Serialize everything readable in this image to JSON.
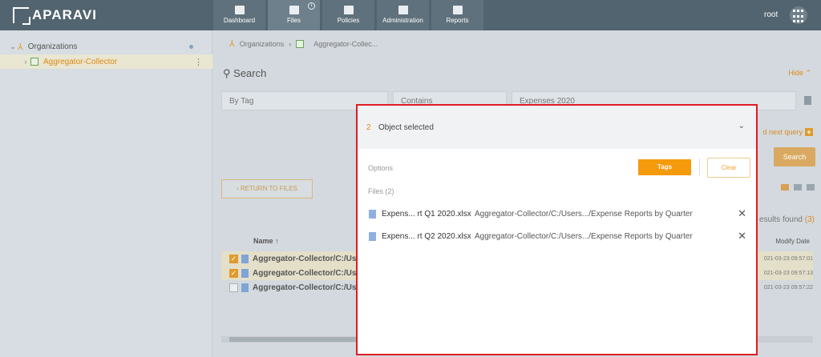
{
  "brand": {
    "name": "APARAVI"
  },
  "nav": {
    "items": [
      {
        "label": "Dashboard",
        "icon": "dashboard-icon"
      },
      {
        "label": "Files",
        "icon": "folder-icon"
      },
      {
        "label": "Policies",
        "icon": "policies-icon"
      },
      {
        "label": "Administration",
        "icon": "administration-icon"
      },
      {
        "label": "Reports",
        "icon": "reports-icon"
      }
    ],
    "active": "Files"
  },
  "user": {
    "name": "root"
  },
  "sidebar": {
    "items": [
      {
        "label": "Organizations"
      },
      {
        "label": "Aggregator-Collector"
      }
    ]
  },
  "breadcrumb": {
    "items": [
      "Organizations",
      "Aggregator-Collec..."
    ]
  },
  "search": {
    "title": "Search",
    "hide_label": "Hide",
    "filter_field": "By Tag",
    "operator": "Contains",
    "value": "Expenses 2020",
    "next_query_label": "d next query",
    "search_label": "Search"
  },
  "results": {
    "return_label": "RETURN TO FILES",
    "found_text": "esults found",
    "count": "(3)",
    "col_name": "Name",
    "col_date": "Modify Date",
    "rows": [
      {
        "name": "Aggregator-Collector/C:/Use",
        "date": "021-03-23 09:57:01",
        "checked": true
      },
      {
        "name": "Aggregator-Collector/C:/Use",
        "date": "021-03-23 09:57:13",
        "checked": true
      },
      {
        "name": "Aggregator-Collector/C:/Use",
        "date": "021-03-23 09:57:22",
        "checked": false
      }
    ]
  },
  "modal": {
    "count": "2",
    "title": "Object selected",
    "options_label": "Options",
    "tags_label": "Tags",
    "clear_label": "Clear",
    "files_label": "Files (2)",
    "files": [
      {
        "name": "Expens... rt Q1 2020.xlsx",
        "path": "Aggregator-Collector/C:/Users.../Expense Reports by Quarter"
      },
      {
        "name": "Expens... rt Q2 2020.xlsx",
        "path": "Aggregator-Collector/C:/Users.../Expense Reports by Quarter"
      }
    ]
  },
  "colors": {
    "accent": "#f59a0c",
    "highlight_border": "#e01b22",
    "topbar": "#52646f"
  }
}
